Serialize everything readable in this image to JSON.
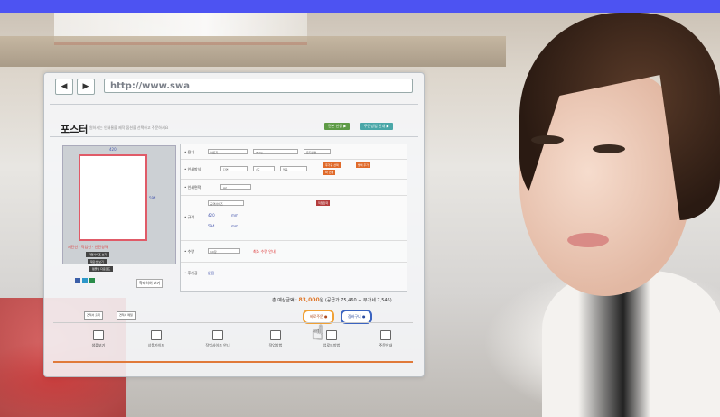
{
  "browser": {
    "back": "◀",
    "forward": "▶",
    "url": "http://www.swa"
  },
  "page": {
    "title": "포스터",
    "subtitle": "원하시는 인쇄물을 제작 옵션을 선택하고 주문하세요",
    "tab1": "견본 신청 ▶",
    "tab2": "주문방법 안내 ▶"
  },
  "preview": {
    "w_label": "420",
    "h_label": "594",
    "plabel": "재단선 · 작업선 · 안전영역",
    "btns": [
      "작업사이즈 보기",
      "재단선 보기"
    ],
    "btn3": "템플릿 다운로드",
    "zoom": "확대하여 보기"
  },
  "form": {
    "rows": [
      {
        "label": "• 용지",
        "sel1": "아트지",
        "sel2": "150g",
        "extra": "용지설명"
      },
      {
        "label": "• 인쇄방식",
        "sel1": "단면",
        "sel2": "4도",
        "sel3": "없음"
      },
      {
        "label": "• 인쇄면적",
        "sel1": "A2"
      },
      {
        "label": "• 규격",
        "sel1": "규격사이즈",
        "w": "420",
        "h": "594"
      },
      {
        "label": "• 수량",
        "sel1": "10장",
        "note": "최소 수량 안내"
      },
      {
        "label": "• 후가공",
        "sel1": "없음"
      }
    ],
    "orange1": "후가공 선택",
    "orange2": "별색 추가",
    "orange3": "박 인쇄",
    "red_btn": "직접입력",
    "mm": "mm"
  },
  "price": {
    "label": "총 예상금액 :",
    "value": "83,000",
    "unit": "원",
    "detail": "(공급가 75,460 + 부가세 7,546)"
  },
  "buttons": {
    "order": "바로주문 ●",
    "cart": "장바구니 ●",
    "s1": "견적서 출력",
    "s2": "견적서 메일"
  },
  "icons": [
    {
      "name": "샘플보기",
      "icon": "window-icon"
    },
    {
      "name": "상품가이드",
      "icon": "card-icon"
    },
    {
      "name": "작업사이즈 안내",
      "icon": "ruler-icon"
    },
    {
      "name": "작업방법",
      "icon": "doc-icon"
    },
    {
      "name": "업로드방법",
      "icon": "upload-icon"
    },
    {
      "name": "주문안내",
      "icon": "edit-icon"
    }
  ],
  "colors": {
    "topbar": "#4d53f2",
    "accent": "#e0782a",
    "cart": "#3b64c0"
  }
}
